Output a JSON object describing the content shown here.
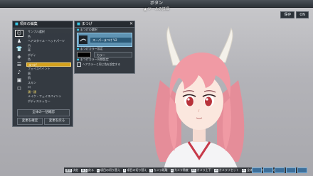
{
  "top": {
    "title": "ボタン",
    "subtitle": "▲ ツールの詳細",
    "buttons": [
      "保存",
      "ON"
    ]
  },
  "left_panel": {
    "title": "項目の編集",
    "items": [
      "サンプル選択",
      "色",
      "ヘアスタイル・ヘッドパーツ",
      "目",
      "耳",
      "ボディ",
      "色",
      "まつげ",
      "フェイスペイント",
      "眉",
      "肌",
      "スキン",
      "口",
      "頭・顔",
      "メイク・フェイスペイント",
      "ボディステッカー"
    ],
    "selected_index": 7,
    "current_index": 13,
    "button_all": "全体の一括確認",
    "button_apply": "変更を確定",
    "button_cancel": "変更を戻る"
  },
  "right_panel": {
    "title": "まつげ",
    "section_type": "まつげの選択",
    "type_name": "スーパーまつげ V2",
    "section_color": "まつげカラー設定",
    "color_button": "カラー",
    "swatch_color": "#000000",
    "section_options": "まつげカラー同期設定",
    "checkbox_label": "ヘアカラーと同じ色を設定する"
  },
  "bottom_bar": {
    "hints": [
      {
        "key": "選択",
        "label": "決定"
      },
      {
        "key": "戻る",
        "label": "戻る"
      },
      {
        "key": "L",
        "label": "項目の切り替え"
      },
      {
        "key": "R",
        "label": "項目の切り替え"
      },
      {
        "key": "Y",
        "label": "カメラ距離"
      },
      {
        "key": "X",
        "label": "カメラ角度"
      },
      {
        "key": "RS",
        "label": "カメラ上下"
      },
      {
        "key": "LS",
        "label": "カメラリセット"
      },
      {
        "key": "ZL",
        "label": "全体ウィンドウを開く"
      }
    ]
  },
  "colors": {
    "accent_cyan": "#38c8e8",
    "selected_gold": "#d5a21e",
    "type_blue": "#5f93b3",
    "hair_pink": "#f09aa4",
    "horn_white": "#f4f1ea",
    "eye_red": "#b8323a"
  }
}
